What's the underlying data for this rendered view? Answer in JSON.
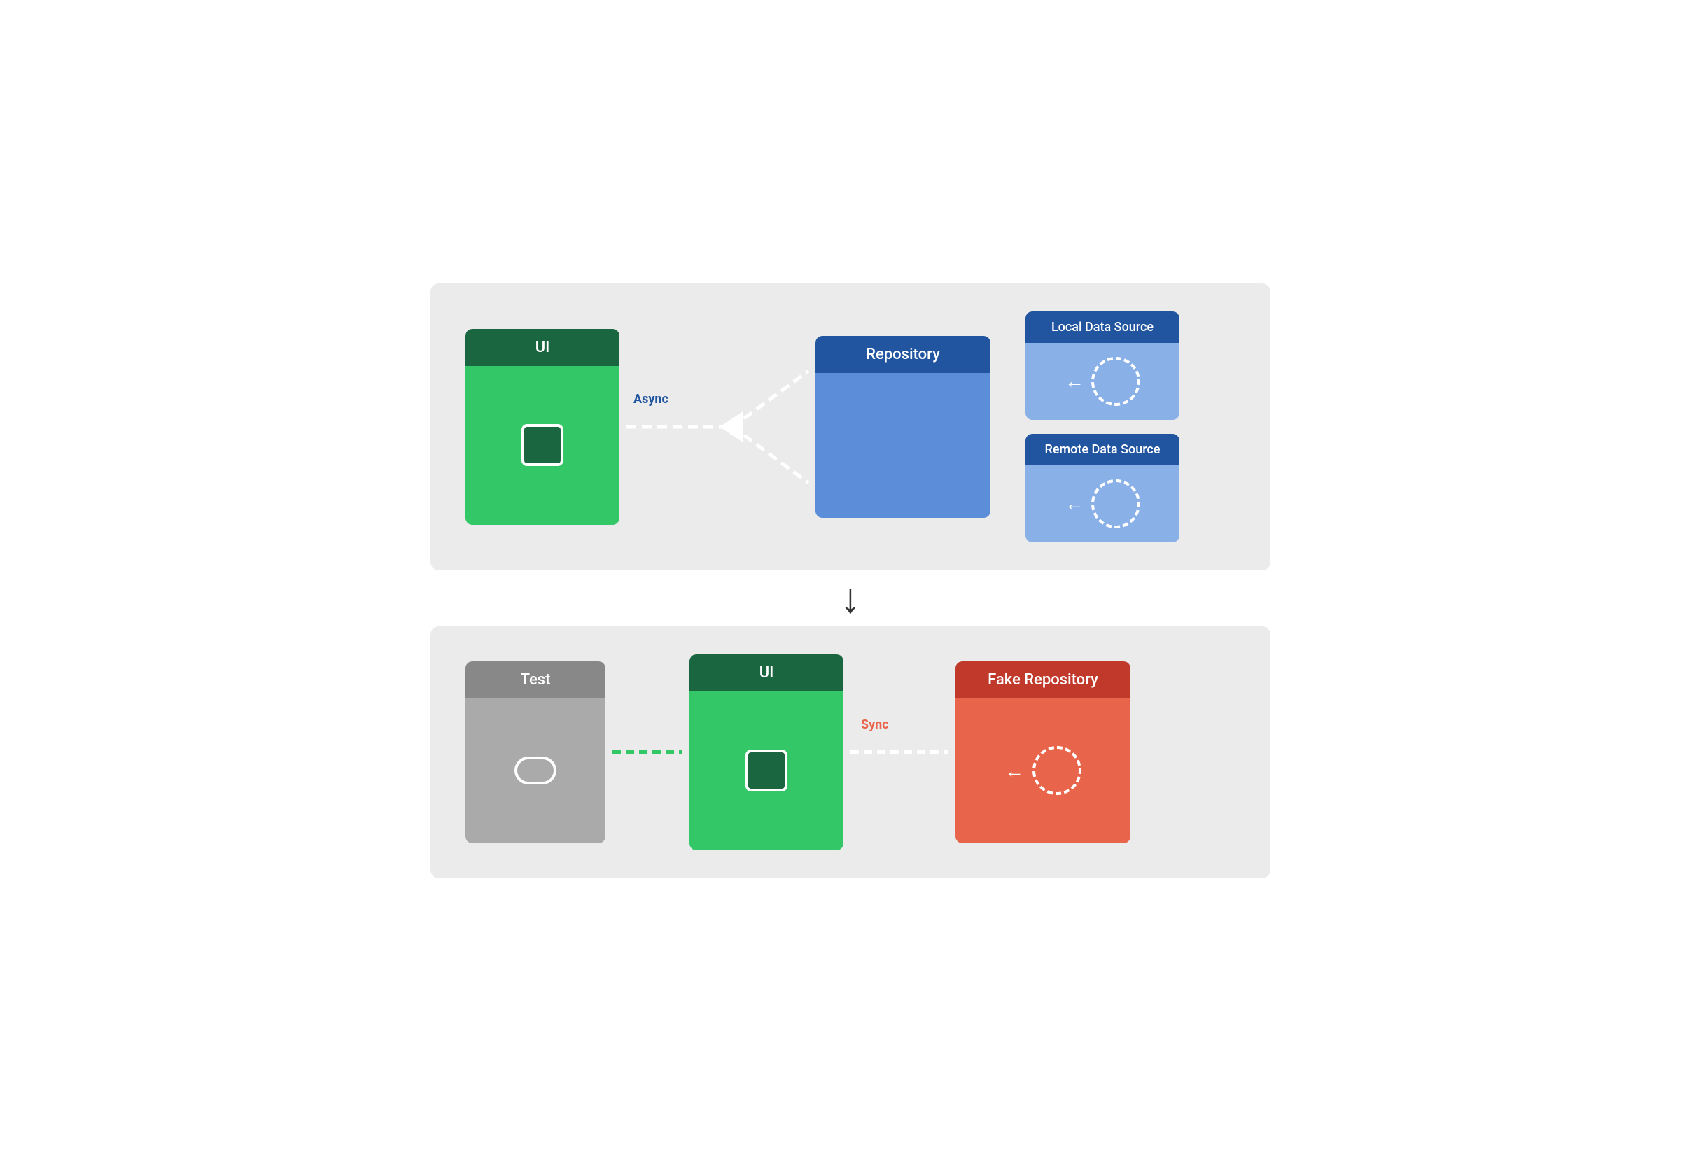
{
  "top_diagram": {
    "ui": {
      "header": "UI",
      "header_bg": "#1a6640",
      "body_bg": "#34c767"
    },
    "repository": {
      "header": "Repository",
      "header_bg": "#2255a0",
      "body_bg": "#5b8dd9"
    },
    "local_data_source": {
      "header": "Local Data Source",
      "header_bg": "#2255a0",
      "body_bg": "#8ab0e8"
    },
    "remote_data_source": {
      "header": "Remote Data Source",
      "header_bg": "#2255a0",
      "body_bg": "#8ab0e8"
    },
    "connection_label": "Async"
  },
  "bottom_diagram": {
    "test": {
      "header": "Test",
      "header_bg": "#888888",
      "body_bg": "#aaaaaa"
    },
    "ui": {
      "header": "UI",
      "header_bg": "#1a6640",
      "body_bg": "#34c767"
    },
    "fake_repository": {
      "header": "Fake Repository",
      "header_bg": "#c0392b",
      "body_bg": "#e8644a"
    },
    "connection_label": "Sync"
  },
  "arrow": "↓"
}
